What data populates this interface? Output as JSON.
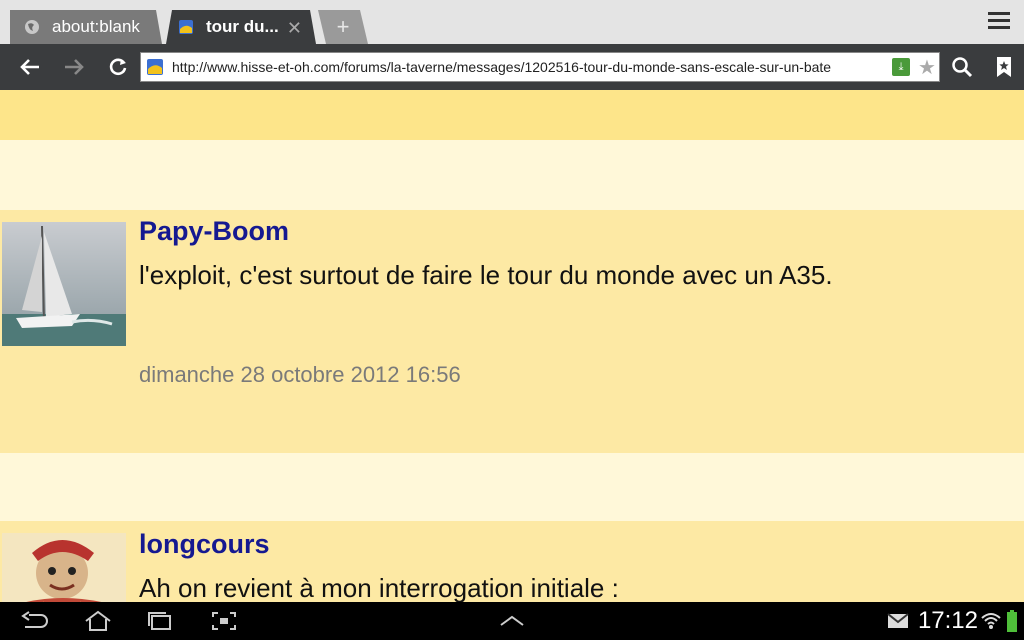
{
  "tabs": [
    {
      "title": "about:blank",
      "active": false
    },
    {
      "title": "tour du...",
      "active": true
    }
  ],
  "newtab_label": "+",
  "toolbar": {
    "url": "http://www.hisse-et-oh.com/forums/la-taverne/messages/1202516-tour-du-monde-sans-escale-sur-un-bate",
    "ext_label": "⤓"
  },
  "posts": [
    {
      "author": "Papy-Boom",
      "message": "l'exploit, c'est surtout de faire le tour du monde avec un A35.",
      "date": "dimanche 28 octobre 2012 16:56"
    },
    {
      "author": "longcours",
      "message": "Ah on revient à mon interrogation initiale :",
      "date": ""
    }
  ],
  "status": {
    "time": "17:12"
  },
  "colors": {
    "band_dark": "#fde58a",
    "band_light": "#fff8d9",
    "post_bg": "#fde9a4",
    "author": "#151991"
  },
  "icons": {
    "tab1": "globe-icon",
    "tab2": "site-favicon",
    "back": "back-arrow-icon",
    "forward": "forward-arrow-icon",
    "reload": "reload-icon",
    "search": "search-icon",
    "bookmarks": "bookmark-icon",
    "menu": "menu-icon"
  }
}
